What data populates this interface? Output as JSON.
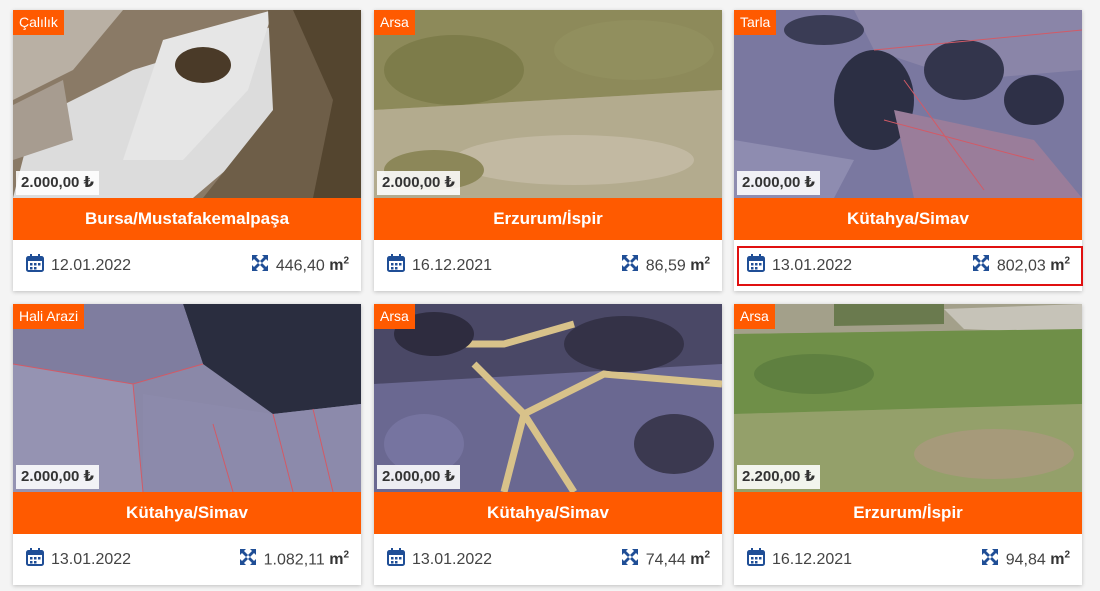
{
  "colors": {
    "accent": "#ff5a00",
    "icon": "#1f4e96",
    "highlight": "#e01010"
  },
  "icons": {
    "date": "calendar-icon",
    "area": "expand-arrows-icon"
  },
  "listings": [
    {
      "category": "Çalılık",
      "price": "2.000,00 ₺",
      "location": "Bursa/Mustafakemalpaşa",
      "date": "12.01.2022",
      "area": "446,40",
      "unit": "m",
      "unit_exp": "2"
    },
    {
      "category": "Arsa",
      "price": "2.000,00 ₺",
      "location": "Erzurum/İspir",
      "date": "16.12.2021",
      "area": "86,59",
      "unit": "m",
      "unit_exp": "2"
    },
    {
      "category": "Tarla",
      "price": "2.000,00 ₺",
      "location": "Kütahya/Simav",
      "date": "13.01.2022",
      "area": "802,03",
      "unit": "m",
      "unit_exp": "2"
    },
    {
      "category": "Hali Arazi",
      "price": "2.000,00 ₺",
      "location": "Kütahya/Simav",
      "date": "13.01.2022",
      "area": "1.082,11",
      "unit": "m",
      "unit_exp": "2"
    },
    {
      "category": "Arsa",
      "price": "2.000,00 ₺",
      "location": "Kütahya/Simav",
      "date": "13.01.2022",
      "area": "74,44",
      "unit": "m",
      "unit_exp": "2"
    },
    {
      "category": "Arsa",
      "price": "2.200,00 ₺",
      "location": "Erzurum/İspir",
      "date": "16.12.2021",
      "area": "94,84",
      "unit": "m",
      "unit_exp": "2"
    }
  ]
}
